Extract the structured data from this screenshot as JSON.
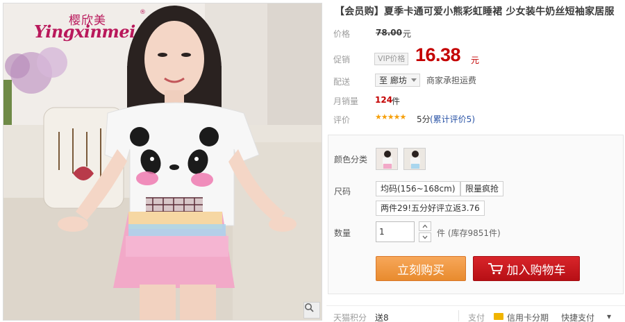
{
  "brand": {
    "name_cn": "樱欣美",
    "name_en": "Yingxinmei",
    "reg": "®"
  },
  "product": {
    "title": "【会员购】夏季卡通可爱小熊彩虹睡裙 少女装牛奶丝短袖家居服"
  },
  "price": {
    "label": "价格",
    "value": "78.00",
    "unit": "元"
  },
  "promo": {
    "label": "促销",
    "tag": "VIP价格",
    "value": "16.38",
    "unit": "元"
  },
  "shipping": {
    "label": "配送",
    "location": "至 廊坊",
    "note": "商家承担运费"
  },
  "sales": {
    "label": "月销量",
    "value": "124",
    "unit": "件"
  },
  "rating": {
    "label": "评价",
    "stars": "★★★★★",
    "score": "5分",
    "review_link": "(累计评价5)"
  },
  "sku": {
    "color_label": "颜色分类",
    "size_label": "尺码",
    "size_options": [
      "均码(156~168cm)",
      "限量疯抢",
      "两件29!五分好评立返3.76"
    ],
    "qty_label": "数量",
    "qty_value": "1",
    "stock_text": "件 (库存9851件)"
  },
  "actions": {
    "buy_now": "立刻购买",
    "add_to_cart": "加入购物车"
  },
  "bottom": {
    "points_label": "天猫积分",
    "points_value": "送8",
    "pay_label": "支付",
    "card_installment": "信用卡分期",
    "quick_pay": "快捷支付"
  },
  "colors": {
    "price_red": "#c40000",
    "buy_orange": "#e88b2e",
    "cart_red": "#c4161c",
    "link_blue": "#2953a6",
    "brand_magenta": "#b9185b"
  }
}
